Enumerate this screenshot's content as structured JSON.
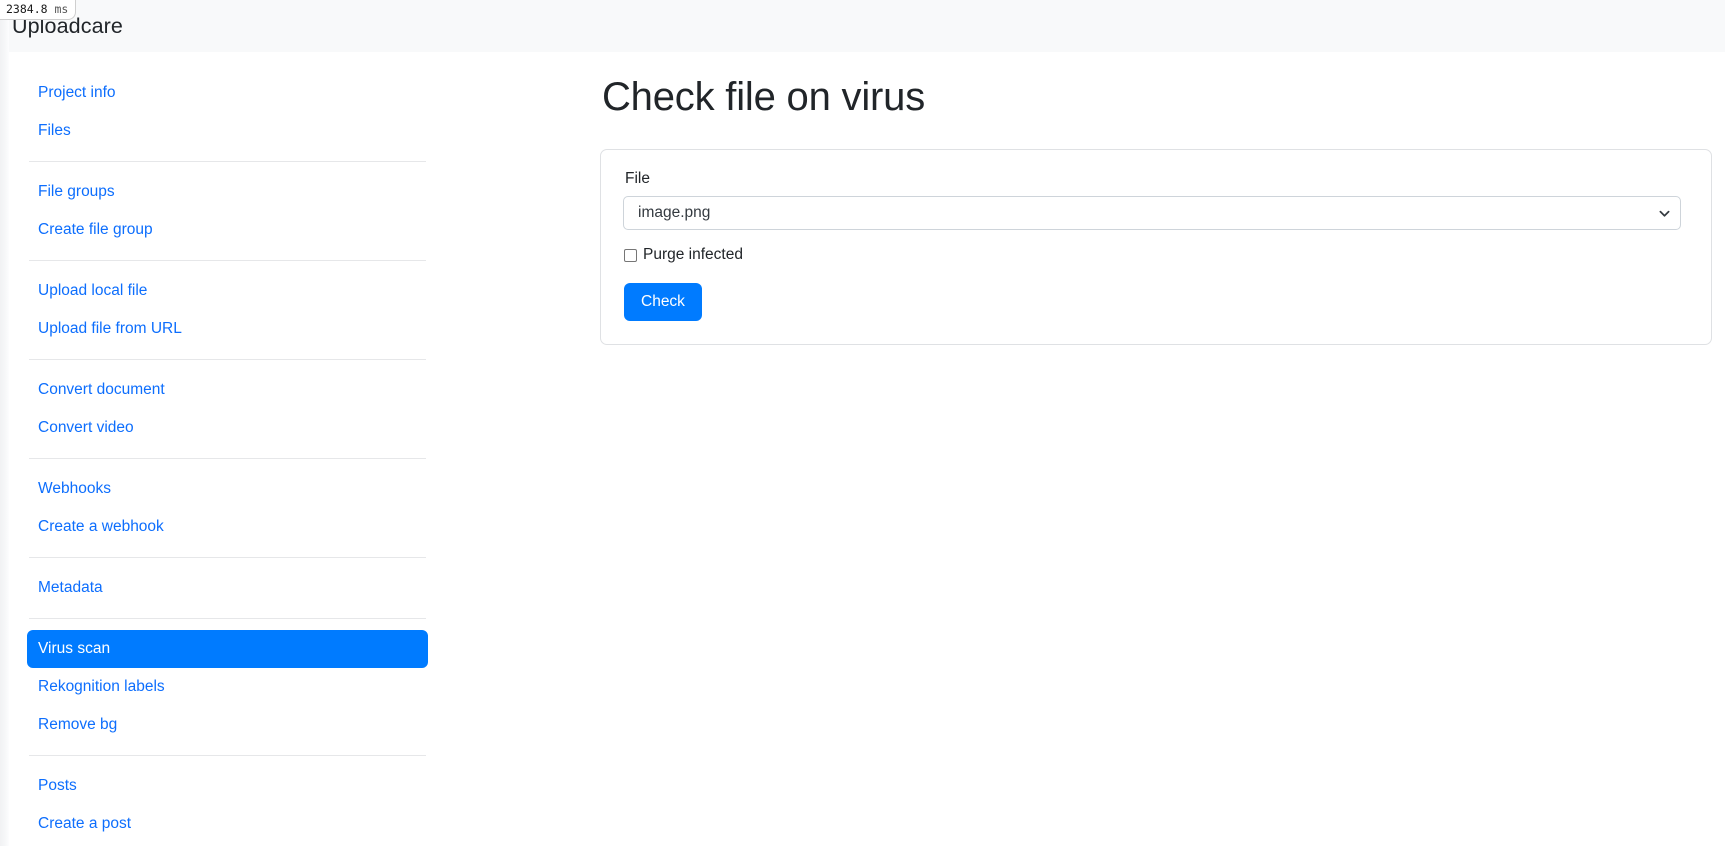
{
  "perf": {
    "value": "2384.8",
    "unit": "ms"
  },
  "header": {
    "title": "Uploadcare"
  },
  "sidebar": {
    "groups": [
      {
        "items": [
          {
            "label": "Project info",
            "active": false
          },
          {
            "label": "Files",
            "active": false
          }
        ]
      },
      {
        "items": [
          {
            "label": "File groups",
            "active": false
          },
          {
            "label": "Create file group",
            "active": false
          }
        ]
      },
      {
        "items": [
          {
            "label": "Upload local file",
            "active": false
          },
          {
            "label": "Upload file from URL",
            "active": false
          }
        ]
      },
      {
        "items": [
          {
            "label": "Convert document",
            "active": false
          },
          {
            "label": "Convert video",
            "active": false
          }
        ]
      },
      {
        "items": [
          {
            "label": "Webhooks",
            "active": false
          },
          {
            "label": "Create a webhook",
            "active": false
          }
        ]
      },
      {
        "items": [
          {
            "label": "Metadata",
            "active": false
          }
        ]
      },
      {
        "items": [
          {
            "label": "Virus scan",
            "active": true
          },
          {
            "label": "Rekognition labels",
            "active": false
          },
          {
            "label": "Remove bg",
            "active": false
          }
        ]
      },
      {
        "items": [
          {
            "label": "Posts",
            "active": false
          },
          {
            "label": "Create a post",
            "active": false
          }
        ]
      }
    ]
  },
  "main": {
    "page_title": "Check file on virus",
    "form": {
      "file_label": "File",
      "file_selected": "image.png",
      "file_options": [
        "image.png"
      ],
      "purge_label": "Purge infected",
      "purge_checked": false,
      "submit_label": "Check"
    }
  },
  "colors": {
    "accent": "#007bff",
    "link": "#0d6efd",
    "header_bg": "#f8f9fa",
    "text": "#212529",
    "border": "#dfe1e4"
  }
}
